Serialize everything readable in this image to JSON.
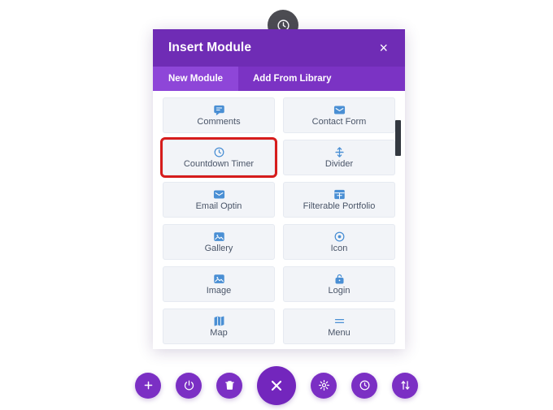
{
  "badge": {
    "icon": "clock-icon"
  },
  "modal": {
    "title": "Insert Module",
    "close_label": "×",
    "tabs": [
      {
        "label": "New Module",
        "active": true
      },
      {
        "label": "Add From Library",
        "active": false
      }
    ],
    "modules": [
      {
        "label": "Comments",
        "icon": "speech-bubble-icon",
        "highlighted": false
      },
      {
        "label": "Contact Form",
        "icon": "envelope-icon",
        "highlighted": false
      },
      {
        "label": "Countdown Timer",
        "icon": "clock-icon",
        "highlighted": true
      },
      {
        "label": "Divider",
        "icon": "vertical-double-arrow-icon",
        "highlighted": false
      },
      {
        "label": "Email Optin",
        "icon": "envelope-icon",
        "highlighted": false
      },
      {
        "label": "Filterable Portfolio",
        "icon": "grid-window-icon",
        "highlighted": false
      },
      {
        "label": "Gallery",
        "icon": "image-icon",
        "highlighted": false
      },
      {
        "label": "Icon",
        "icon": "target-circle-icon",
        "highlighted": false
      },
      {
        "label": "Image",
        "icon": "image-icon",
        "highlighted": false
      },
      {
        "label": "Login",
        "icon": "padlock-icon",
        "highlighted": false
      },
      {
        "label": "Map",
        "icon": "map-icon",
        "highlighted": false
      },
      {
        "label": "Menu",
        "icon": "hamburger-lines-icon",
        "highlighted": false
      }
    ]
  },
  "toolbar": {
    "buttons": [
      {
        "name": "add-button",
        "icon": "plus-icon",
        "main": false
      },
      {
        "name": "power-button",
        "icon": "power-icon",
        "main": false
      },
      {
        "name": "trash-button",
        "icon": "trash-icon",
        "main": false
      },
      {
        "name": "close-button",
        "icon": "close-x-icon",
        "main": true
      },
      {
        "name": "settings-button",
        "icon": "gear-icon",
        "main": false
      },
      {
        "name": "history-button",
        "icon": "clock-icon",
        "main": false
      },
      {
        "name": "reorder-button",
        "icon": "up-down-arrows-icon",
        "main": false
      }
    ]
  },
  "colors": {
    "header_purple": "#6f2cb5",
    "tabbar_purple": "#7b33c4",
    "active_tab_purple": "#8e46d8",
    "accent_blue": "#4a8fd4",
    "highlight_red": "#d61c1c",
    "card_bg": "#f2f4f8",
    "badge_gray": "#4c4c52"
  }
}
